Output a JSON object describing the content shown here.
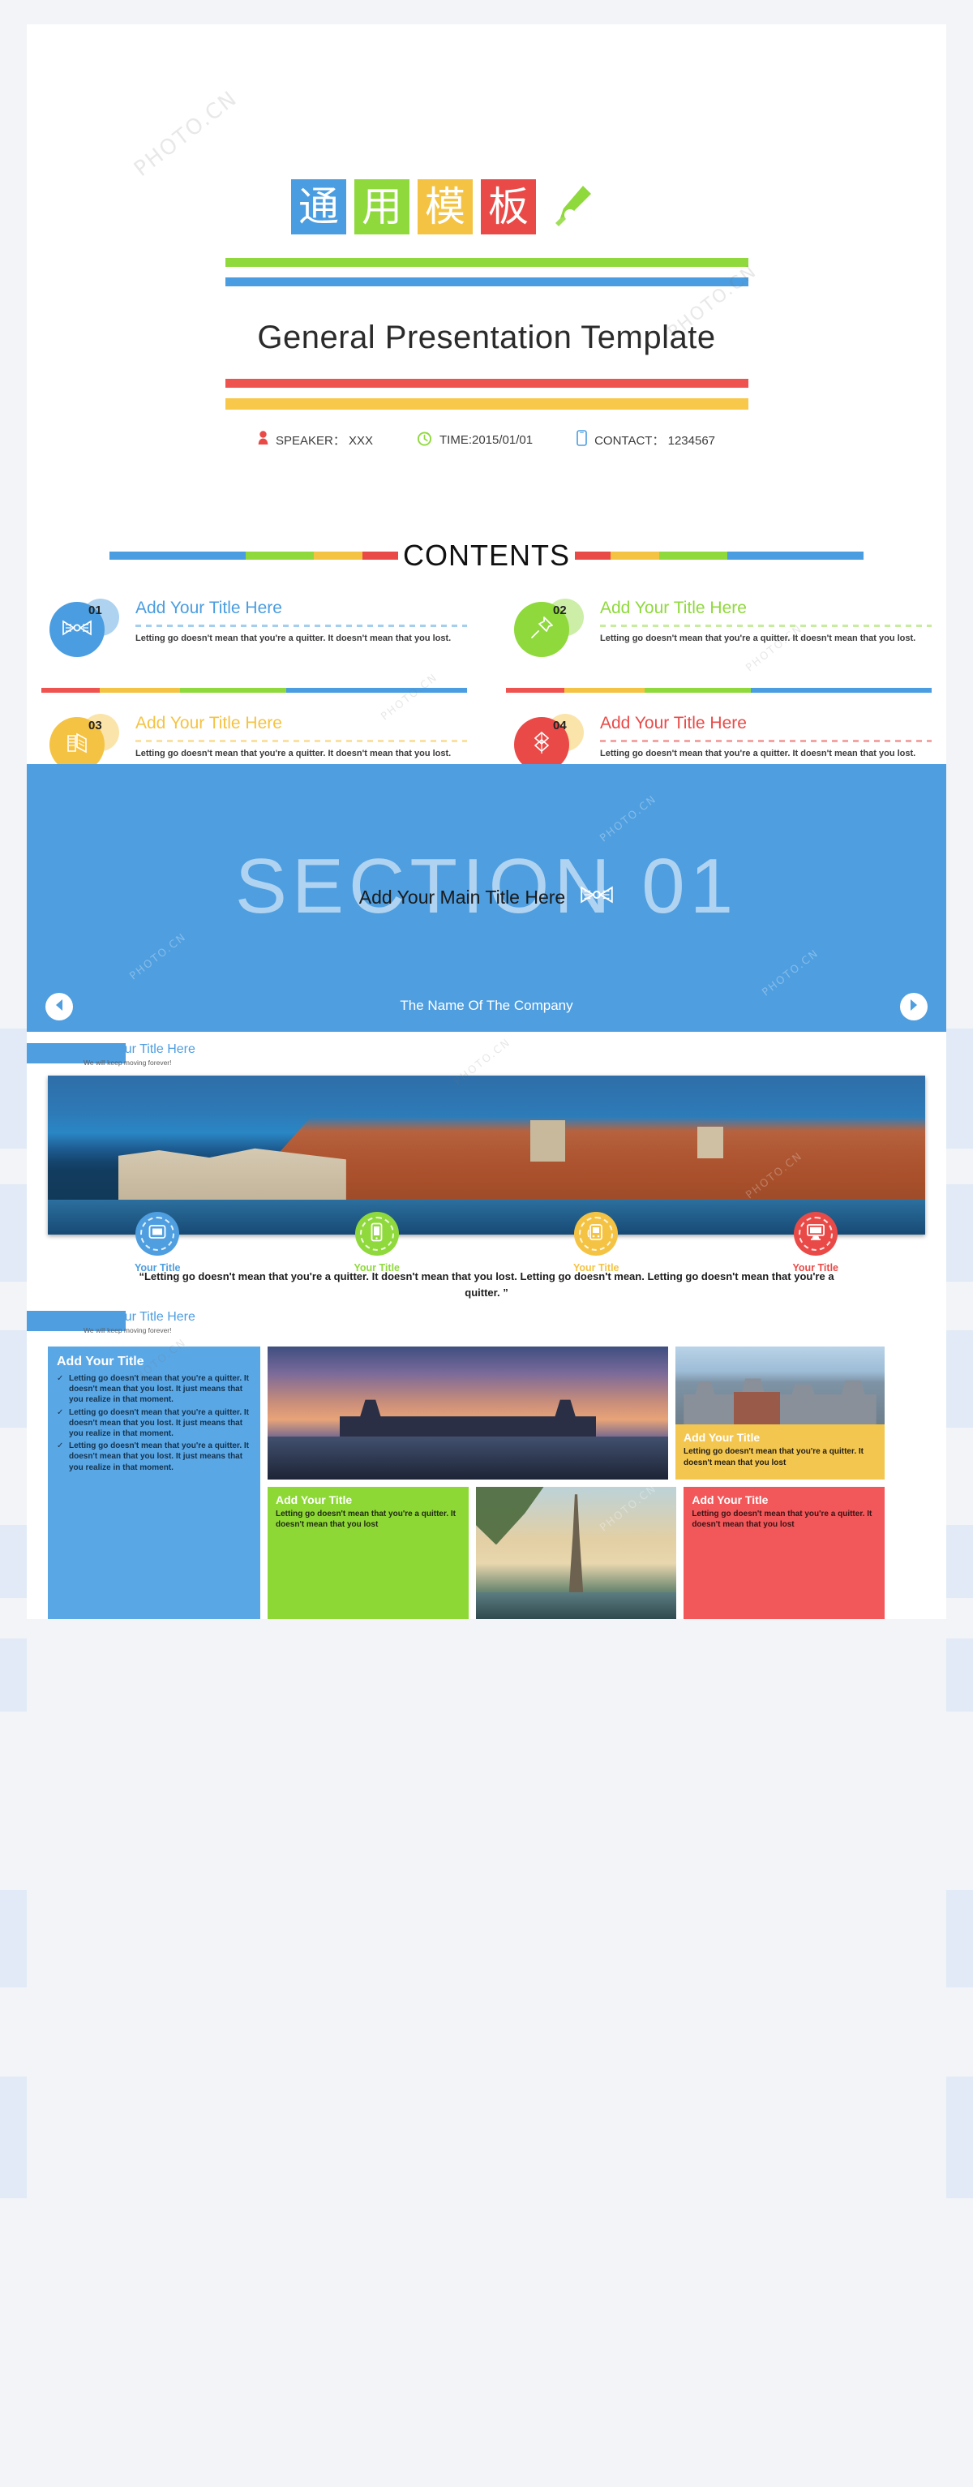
{
  "theme": {
    "blue": "#4a9de0",
    "green": "#8fd93c",
    "yellow": "#f5c343",
    "red": "#ea4a47",
    "section_bg": "#4e9ee0"
  },
  "slide1": {
    "cjk_blocks": [
      {
        "char": "通",
        "color": "#4a9de0"
      },
      {
        "char": "用",
        "color": "#8fd93c"
      },
      {
        "char": "模",
        "color": "#f5c343"
      },
      {
        "char": "板",
        "color": "#ea4a47"
      }
    ],
    "pen_icon": "pencil-icon",
    "main_title": "General Presentation Template",
    "meta": [
      {
        "icon": "person-icon",
        "text": "SPEAKER： XXX"
      },
      {
        "icon": "clock-icon",
        "text": "TIME:2015/01/01"
      },
      {
        "icon": "phone-icon",
        "text": "CONTACT： 1234567"
      }
    ]
  },
  "slide2": {
    "heading": "CONTENTS",
    "items": [
      {
        "num": "01",
        "color": "#4a9de0",
        "icon": "bowtie-icon",
        "title": "Add Your Title Here",
        "desc": "Letting go doesn't mean that you're a quitter. It doesn't mean that you lost."
      },
      {
        "num": "02",
        "color": "#8fd93c",
        "icon": "pushpin-icon",
        "title": "Add Your Title Here",
        "desc": "Letting go doesn't mean that you're a quitter. It doesn't mean that you lost."
      },
      {
        "num": "03",
        "color": "#f5c343",
        "icon": "book-icon",
        "title": "Add Your Title Here",
        "desc": "Letting go doesn't mean that you're a quitter. It doesn't mean that you lost."
      },
      {
        "num": "04",
        "color": "#ea4a47",
        "icon": "wheat-icon",
        "title": "Add Your Title Here",
        "desc": "Letting go doesn't mean that you're a quitter. It doesn't mean that you lost."
      }
    ]
  },
  "slide3": {
    "ghost_text": "SECTION 01",
    "main_title": "Add Your Main Title Here",
    "main_icon": "bowtie-icon",
    "company": "The Name Of The Company",
    "prev_icon": "chevron-left-icon",
    "next_icon": "chevron-right-icon"
  },
  "slide4": {
    "header_title": "Add Your Title Here",
    "header_sub": "We will keep moving forever!",
    "photo": "dubrovnik-harbour-photo",
    "icons": [
      {
        "label": "Your Title",
        "color": "#4e9ee0",
        "icon": "tablet-icon"
      },
      {
        "label": "Your Title",
        "color": "#8fd93c",
        "icon": "smartphone-icon"
      },
      {
        "label": "Your Title",
        "color": "#f5c343",
        "icon": "handheld-console-icon"
      },
      {
        "label": "Your Title",
        "color": "#ea4a47",
        "icon": "desktop-monitor-icon"
      }
    ],
    "quote": "“Letting go doesn't mean that you're a quitter. It doesn't mean that you lost. Letting go doesn't mean. Letting go doesn't mean that you're a quitter. ”"
  },
  "slide5": {
    "header_title": "Add Your Title Here",
    "header_sub": "We will keep moving forever!",
    "blue_card": {
      "title": "Add Your Title",
      "bullets": [
        "Letting go doesn't mean that you're a quitter. It doesn't mean that you lost. It just means that you realize in that moment.",
        "Letting go doesn't mean that you're a quitter. It doesn't mean that you lost. It just means that you realize in that moment.",
        "Letting go doesn't mean that you're a quitter. It doesn't mean that you lost. It just means that you realize in that moment."
      ]
    },
    "bridge_photo": "oberbaum-bridge-sunset-photo",
    "city_card": {
      "photo": "city-skyline-photo",
      "title": "Add Your Title",
      "text": "Letting go doesn't mean that you're a quitter. It doesn't mean that you lost"
    },
    "green_card": {
      "title": "Add Your Title",
      "text": "Letting go doesn't mean that you're a quitter. It doesn't mean that you lost"
    },
    "eiffel_photo": "eiffel-tower-photo",
    "red_card": {
      "title": "Add Your Title",
      "text": "Letting go doesn't mean that you're a quitter. It doesn't mean that you lost"
    }
  },
  "watermark": "PHOTO.CN"
}
